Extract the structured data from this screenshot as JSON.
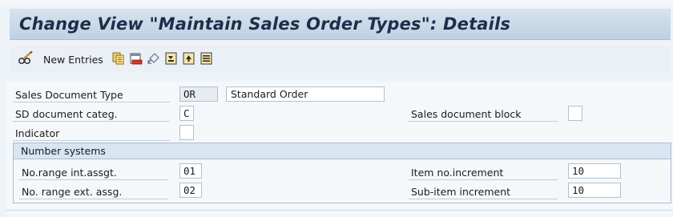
{
  "title": "Change View \"Maintain Sales Order Types\": Details",
  "toolbar": {
    "new_entries_label": "New Entries",
    "icons": [
      "display-change-icon",
      "copy-icon",
      "delete-icon",
      "undo-icon",
      "first-entry-icon",
      "previous-entry-icon",
      "next-entry-icon"
    ]
  },
  "fields": {
    "sales_document_type": {
      "label": "Sales Document Type",
      "code": "OR",
      "description": "Standard Order"
    },
    "sd_document_categ": {
      "label": "SD document categ.",
      "value": "C"
    },
    "sales_document_block": {
      "label": "Sales document block",
      "value": ""
    },
    "indicator": {
      "label": "Indicator",
      "value": ""
    }
  },
  "number_systems": {
    "header": "Number systems",
    "no_range_int": {
      "label": "No.range int.assgt.",
      "value": "01"
    },
    "no_range_ext": {
      "label": "No. range ext. assg.",
      "value": "02"
    },
    "item_no_increment": {
      "label": "Item no.increment",
      "value": "10"
    },
    "sub_item_increment": {
      "label": "Sub-item increment",
      "value": "10"
    }
  },
  "colors": {
    "title_bar": "#c9d9e8",
    "title_text": "#1d2e4a",
    "group_header": "#d9e5f0"
  }
}
